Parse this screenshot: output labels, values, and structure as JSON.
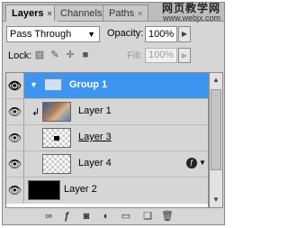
{
  "tabs": [
    {
      "label": "Layers",
      "close": "×"
    },
    {
      "label": "Channels",
      "close": ""
    },
    {
      "label": "Paths",
      "close": "×"
    }
  ],
  "watermark": {
    "line1": "网页教学网",
    "line2": "www.webjx.com"
  },
  "blend_mode": {
    "value": "Pass Through"
  },
  "opacity": {
    "label": "Opacity:",
    "value": "100%"
  },
  "lock": {
    "label": "Lock:"
  },
  "fill": {
    "label": "Fill:",
    "value": "100%"
  },
  "layers": [
    {
      "name": "Group 1",
      "type": "group",
      "selected": true
    },
    {
      "name": "Layer 1",
      "type": "photo",
      "clipped": true
    },
    {
      "name": "Layer 3",
      "type": "transparent"
    },
    {
      "name": "Layer 4",
      "type": "transparent",
      "fx": true
    },
    {
      "name": "Layer 2",
      "type": "black"
    }
  ],
  "bottom_icons": [
    "link-icon",
    "fx-icon",
    "mask-icon",
    "adjustment-icon",
    "folder-icon",
    "new-layer-icon",
    "trash-icon"
  ]
}
